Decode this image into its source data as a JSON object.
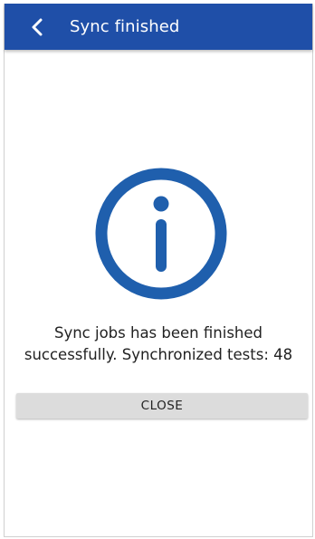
{
  "header": {
    "title": "Sync finished",
    "back_icon": "chevron-left-icon",
    "background_color": "#1f4fa8"
  },
  "main": {
    "icon": "info-icon",
    "icon_color": "#1f5fad",
    "message_line1": "Sync jobs has been finished",
    "message_line2": "successfully. Synchronized tests: 48",
    "close_label": "CLOSE"
  }
}
